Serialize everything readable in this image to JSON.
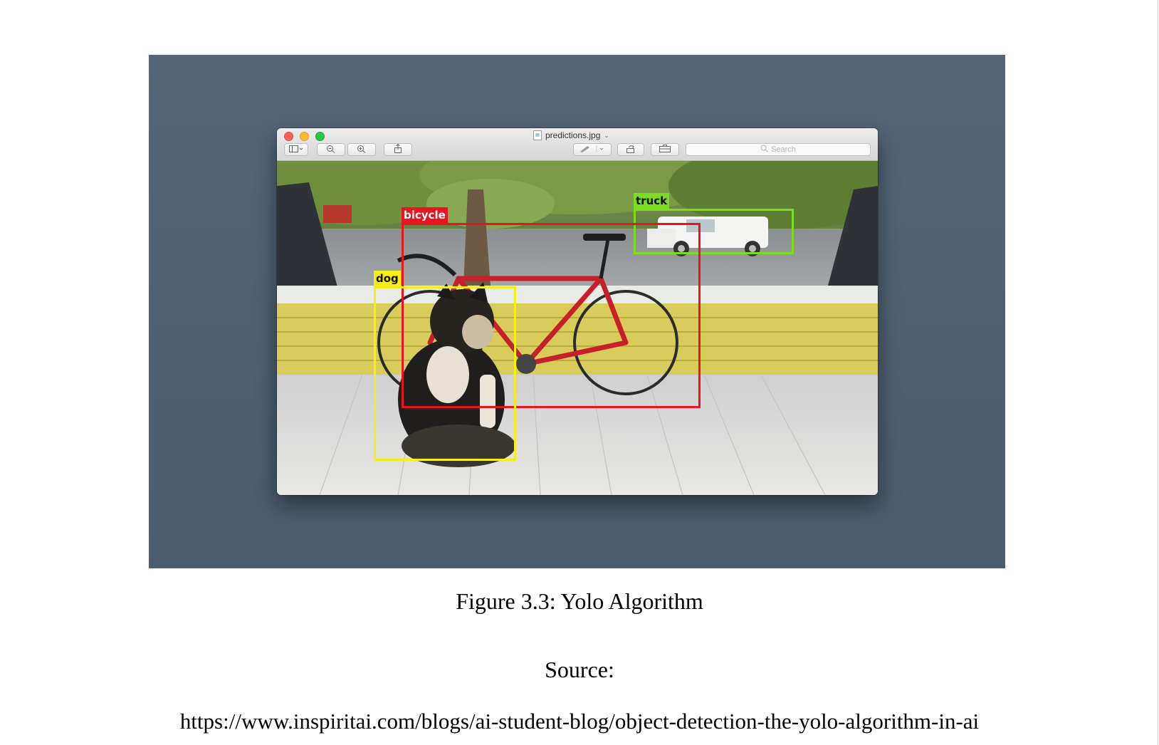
{
  "window": {
    "title": "predictions.jpg",
    "search_placeholder": "Search"
  },
  "detections": [
    {
      "label": "truck",
      "color": "#7ddc1f"
    },
    {
      "label": "bicycle",
      "color": "#e8141f"
    },
    {
      "label": "dog",
      "color": "#f5ee1a"
    }
  ],
  "caption": {
    "title": "Figure 3.3: Yolo Algorithm",
    "source_label": "Source:",
    "source_url": "https://www.inspiritai.com/blogs/ai-student-blog/object-detection-the-yolo-algorithm-in-ai"
  },
  "colors": {
    "panel_background": "#4e6073"
  },
  "icons": [
    "sidebar-icon",
    "zoom-out-icon",
    "zoom-in-icon",
    "share-icon",
    "markup-pen-icon",
    "rotate-icon",
    "toolbox-icon",
    "search-icon"
  ]
}
